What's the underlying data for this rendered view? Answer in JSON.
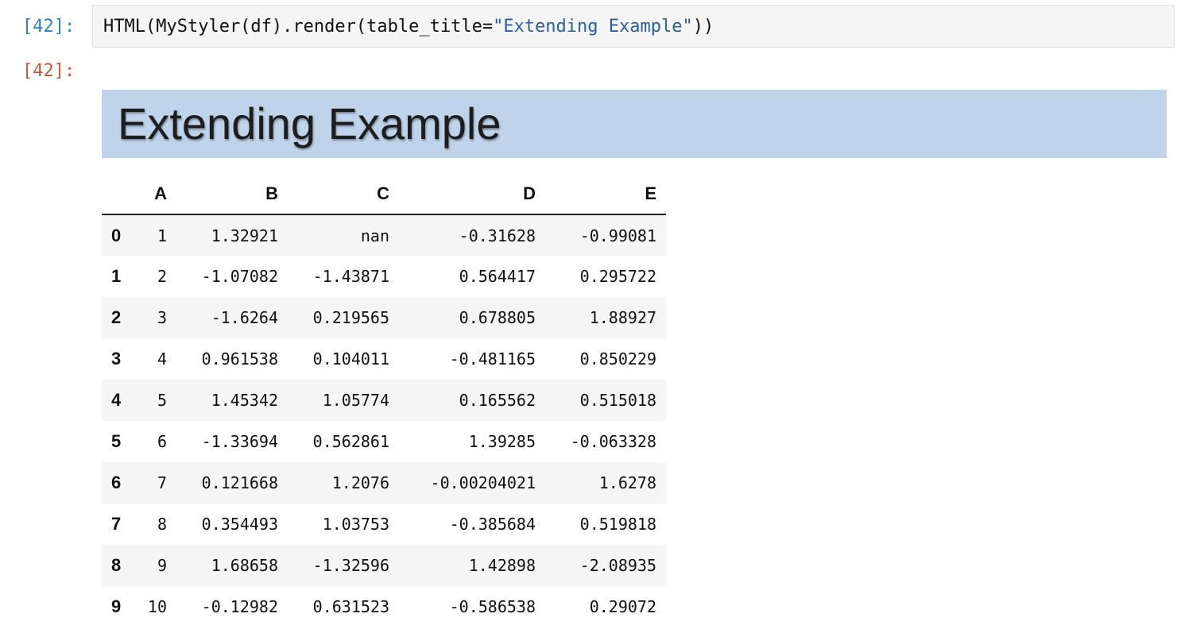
{
  "cell": {
    "in_prompt": "[42]:",
    "out_prompt": "[42]:",
    "code_prefix": "HTML(MyStyler(df).render(table_title=",
    "code_string": "\"Extending Example\"",
    "code_suffix": "))"
  },
  "output": {
    "title": "Extending Example",
    "table": {
      "columns": [
        "",
        "A",
        "B",
        "C",
        "D",
        "E"
      ],
      "rows": [
        {
          "index": "0",
          "values": [
            "1",
            "1.32921",
            "nan",
            "-0.31628",
            "-0.99081"
          ]
        },
        {
          "index": "1",
          "values": [
            "2",
            "-1.07082",
            "-1.43871",
            "0.564417",
            "0.295722"
          ]
        },
        {
          "index": "2",
          "values": [
            "3",
            "-1.6264",
            "0.219565",
            "0.678805",
            "1.88927"
          ]
        },
        {
          "index": "3",
          "values": [
            "4",
            "0.961538",
            "0.104011",
            "-0.481165",
            "0.850229"
          ]
        },
        {
          "index": "4",
          "values": [
            "5",
            "1.45342",
            "1.05774",
            "0.165562",
            "0.515018"
          ]
        },
        {
          "index": "5",
          "values": [
            "6",
            "-1.33694",
            "0.562861",
            "1.39285",
            "-0.063328"
          ]
        },
        {
          "index": "6",
          "values": [
            "7",
            "0.121668",
            "1.2076",
            "-0.00204021",
            "1.6278"
          ]
        },
        {
          "index": "7",
          "values": [
            "8",
            "0.354493",
            "1.03753",
            "-0.385684",
            "0.519818"
          ]
        },
        {
          "index": "8",
          "values": [
            "9",
            "1.68658",
            "-1.32596",
            "1.42898",
            "-2.08935"
          ]
        },
        {
          "index": "9",
          "values": [
            "10",
            "-0.12982",
            "0.631523",
            "-0.586538",
            "0.29072"
          ]
        }
      ]
    }
  },
  "colors": {
    "in_prompt": "#307fc1",
    "out_prompt": "#bf5b3d",
    "title_background": "#bfd3eb",
    "code_string": "#2a5f98",
    "row_stripe": "#f5f5f5"
  }
}
